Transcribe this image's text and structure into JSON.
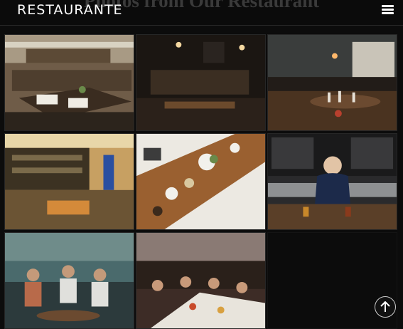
{
  "header": {
    "brand": "RESTAURANTE",
    "section_title": "Photos from Our Restaurant",
    "menu_icon": "hamburger-menu-icon"
  },
  "gallery": {
    "photos": [
      {
        "subject": "dining-room-tables"
      },
      {
        "subject": "dark-bar-interior"
      },
      {
        "subject": "set-table-with-glasses"
      },
      {
        "subject": "cafe-counter-seating"
      },
      {
        "subject": "overhead-long-table"
      },
      {
        "subject": "bartender-at-taps"
      },
      {
        "subject": "friends-on-sofa"
      },
      {
        "subject": "group-dinner-outdoors"
      }
    ]
  },
  "scroll_top": {
    "icon": "arrow-up-icon"
  },
  "colors": {
    "background": "#0c0c0c",
    "header_text": "#ffffff",
    "accent_warm": "#b06b2c"
  }
}
